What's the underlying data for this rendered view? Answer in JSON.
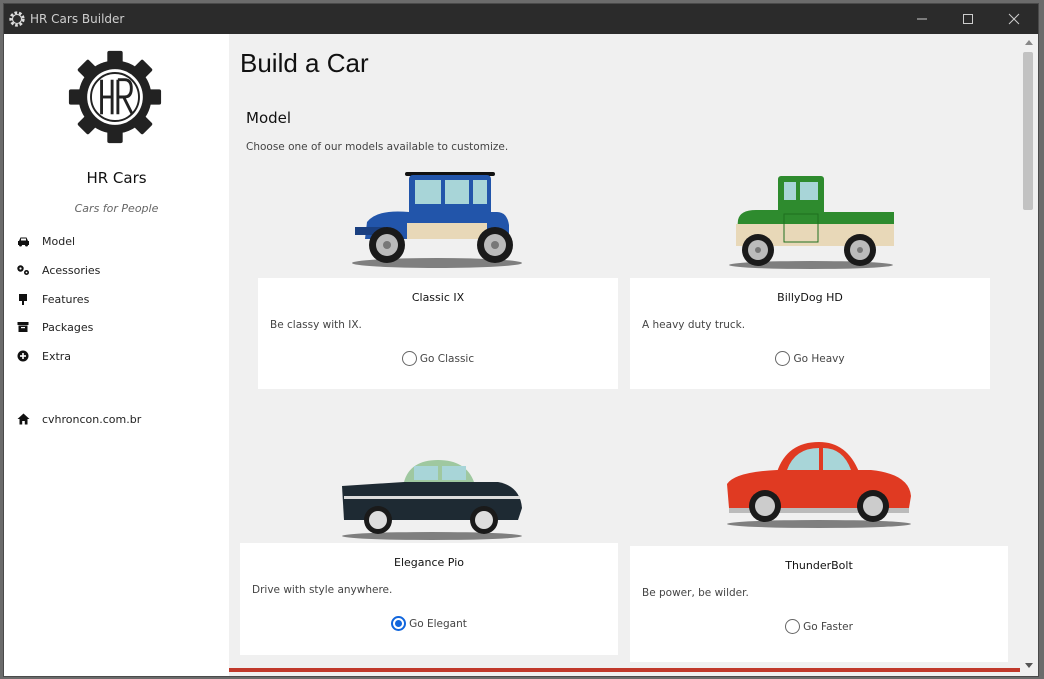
{
  "window": {
    "title": "HR Cars Builder"
  },
  "sidebar": {
    "brand": "HR Cars",
    "tagline": "Cars for People",
    "items": [
      {
        "label": "Model",
        "icon": "car-icon"
      },
      {
        "label": "Acessories",
        "icon": "gears-icon"
      },
      {
        "label": "Features",
        "icon": "plug-icon"
      },
      {
        "label": "Packages",
        "icon": "archive-icon"
      },
      {
        "label": "Extra",
        "icon": "plus-circle-icon"
      }
    ],
    "link": {
      "label": "cvhroncon.com.br",
      "icon": "home-icon"
    }
  },
  "main": {
    "title": "Build a Car",
    "section": "Model",
    "intro": "Choose one of our models available to customize.",
    "cars": [
      {
        "name": "Classic IX",
        "desc": "Be classy with IX.",
        "option": "Go Classic",
        "selected": false,
        "color": "#2255aa"
      },
      {
        "name": "BillyDog HD",
        "desc": "A heavy duty truck.",
        "option": "Go Heavy",
        "selected": false,
        "color": "#2e8b2e"
      },
      {
        "name": "Elegance Pio",
        "desc": "Drive with style anywhere.",
        "option": "Go Elegant",
        "selected": true,
        "color": "#1e2a33"
      },
      {
        "name": "ThunderBolt",
        "desc": "Be power, be wilder.",
        "option": "Go Faster",
        "selected": false,
        "color": "#e03a22"
      }
    ]
  },
  "colors": {
    "accent": "#1166dd",
    "progress": "#c0392b"
  }
}
